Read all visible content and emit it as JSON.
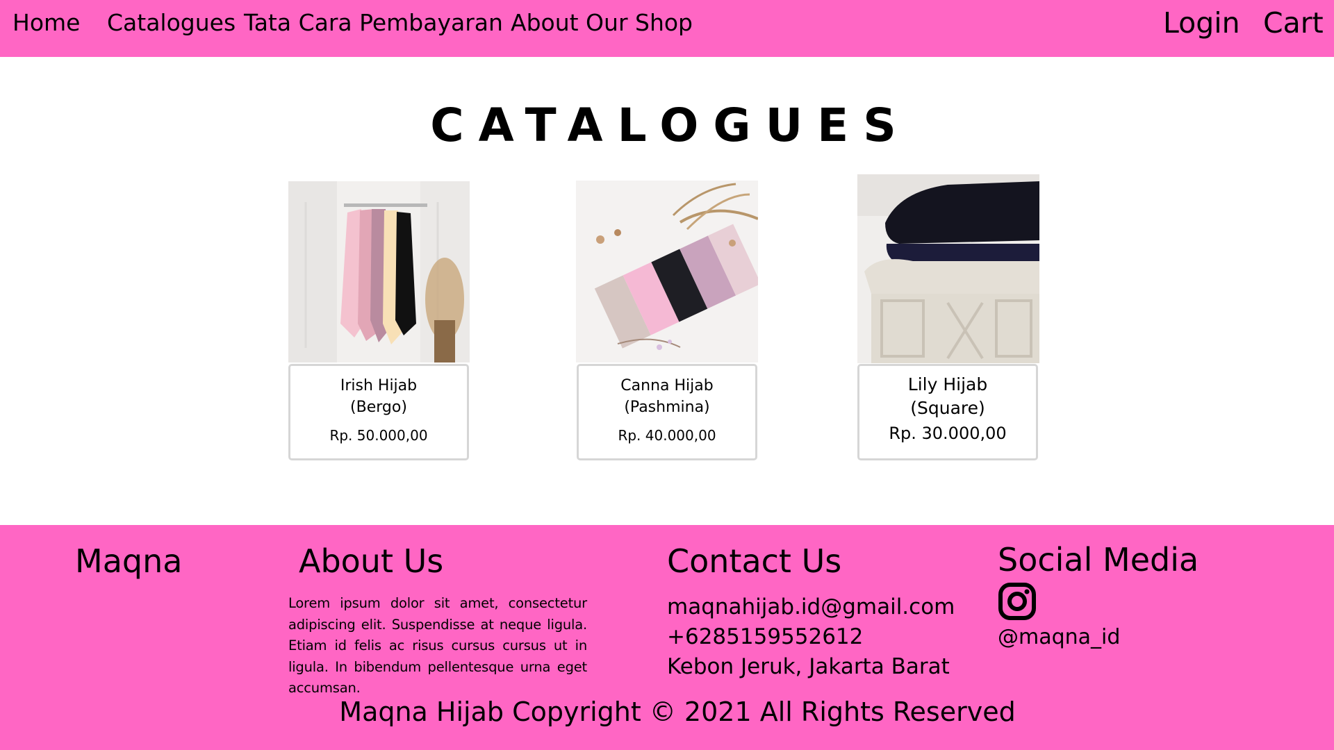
{
  "colors": {
    "brand_pink": "#ff66c4",
    "card_border": "#d6d6d6",
    "text": "#000000"
  },
  "nav": {
    "home": "Home",
    "catalogues": "Catalogues",
    "payment": "Tata Cara Pembayaran",
    "about": "About Our Shop",
    "login": "Login",
    "cart": "Cart"
  },
  "main": {
    "title": "CATALOGUES",
    "products": [
      {
        "name_line1": "Irish Hijab",
        "name_line2": "(Bergo)",
        "price": "Rp. 50.000,00",
        "image": "hanging-hijabs-photo"
      },
      {
        "name_line1": "Canna Hijab",
        "name_line2": "(Pashmina)",
        "price": "Rp. 40.000,00",
        "image": "folded-pashmina-photo"
      },
      {
        "name_line1": "Lily Hijab",
        "name_line2": "(Square)",
        "price": "Rp. 30.000,00",
        "image": "stacked-square-hijab-photo"
      }
    ]
  },
  "footer": {
    "brand": "Maqna",
    "about_heading": "About Us",
    "about_text": "Lorem ipsum dolor sit amet, consectetur adipiscing elit. Suspendisse at neque ligula. Etiam id felis ac risus cursus cursus ut in ligula. In bibendum pellentesque urna eget accumsan.",
    "contact_heading": "Contact Us",
    "email": "maqnahijab.id@gmail.com",
    "phone": "+6285159552612",
    "address": "Kebon Jeruk, Jakarta Barat",
    "social_heading": "Social Media",
    "social_icon": "instagram-icon",
    "instagram_handle": "@maqna_id",
    "copyright": "Maqna Hijab Copyright © 2021 All Rights Reserved"
  }
}
